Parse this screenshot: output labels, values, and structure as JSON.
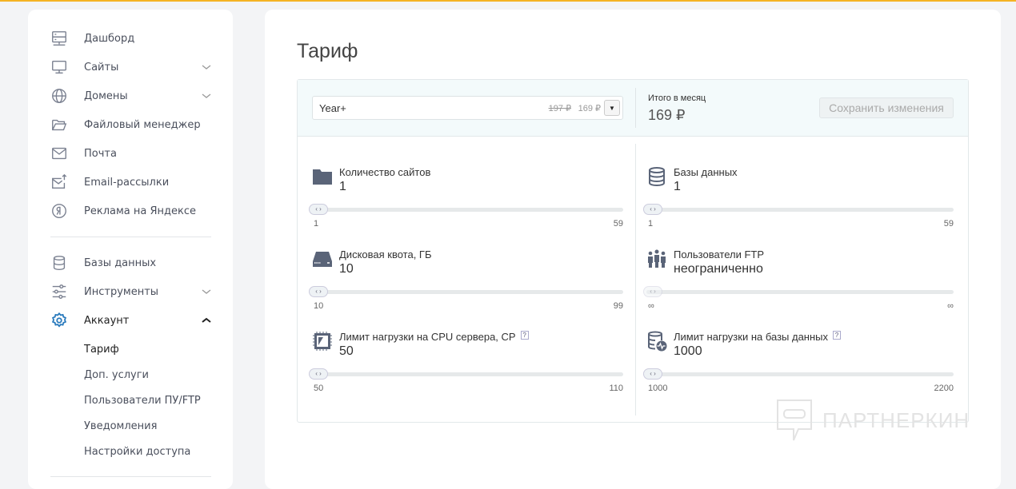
{
  "sidebar": {
    "items": [
      {
        "label": "Дашборд",
        "icon": "server-icon"
      },
      {
        "label": "Сайты",
        "icon": "monitor-icon",
        "expandable": true
      },
      {
        "label": "Домены",
        "icon": "globe-icon",
        "expandable": true
      },
      {
        "label": "Файловый менеджер",
        "icon": "folder-icon"
      },
      {
        "label": "Почта",
        "icon": "mail-icon"
      },
      {
        "label": "Email-рассылки",
        "icon": "mail-send-icon"
      },
      {
        "label": "Реклама на Яндексе",
        "icon": "yandex-icon"
      },
      {
        "label": "Базы данных",
        "icon": "database-icon"
      },
      {
        "label": "Инструменты",
        "icon": "sliders-icon",
        "expandable": true
      },
      {
        "label": "Аккаунт",
        "icon": "gear-icon",
        "expanded": true
      }
    ],
    "subitems": [
      "Тариф",
      "Доп. услуги",
      "Пользователи ПУ/FTP",
      "Уведомления",
      "Настройки доступа"
    ],
    "active_sub": "Тариф"
  },
  "page": {
    "title": "Тариф"
  },
  "tariff": {
    "plan": "Year+",
    "old_price": "197 ₽",
    "new_price": "169 ₽",
    "total_label": "Итого в месяц",
    "total_value": "169 ₽",
    "save_label": "Сохранить изменения"
  },
  "options": [
    {
      "label": "Количество сайтов",
      "value": "1",
      "min": "1",
      "max": "59",
      "fraction": 0
    },
    {
      "label": "Базы данных",
      "value": "1",
      "min": "1",
      "max": "59",
      "fraction": 0
    },
    {
      "label": "Дисковая квота, ГБ",
      "value": "10",
      "min": "10",
      "max": "99",
      "fraction": 0
    },
    {
      "label": "Пользователи FTP",
      "value": "неограниченно",
      "min": "∞",
      "max": "∞",
      "fraction": 0,
      "disabled": true
    },
    {
      "label": "Лимит нагрузки на CPU сервера, CP",
      "value": "50",
      "min": "50",
      "max": "110",
      "fraction": 0,
      "help": "?"
    },
    {
      "label": "Лимит нагрузки на базы данных",
      "value": "1000",
      "min": "1000",
      "max": "2200",
      "fraction": 0,
      "help": "?"
    }
  ],
  "watermark": "ПАРТНЕРКИН",
  "colors": {
    "accent": "#2b7bbd",
    "top_bar": "#f5b324",
    "icon": "#5a6478"
  }
}
